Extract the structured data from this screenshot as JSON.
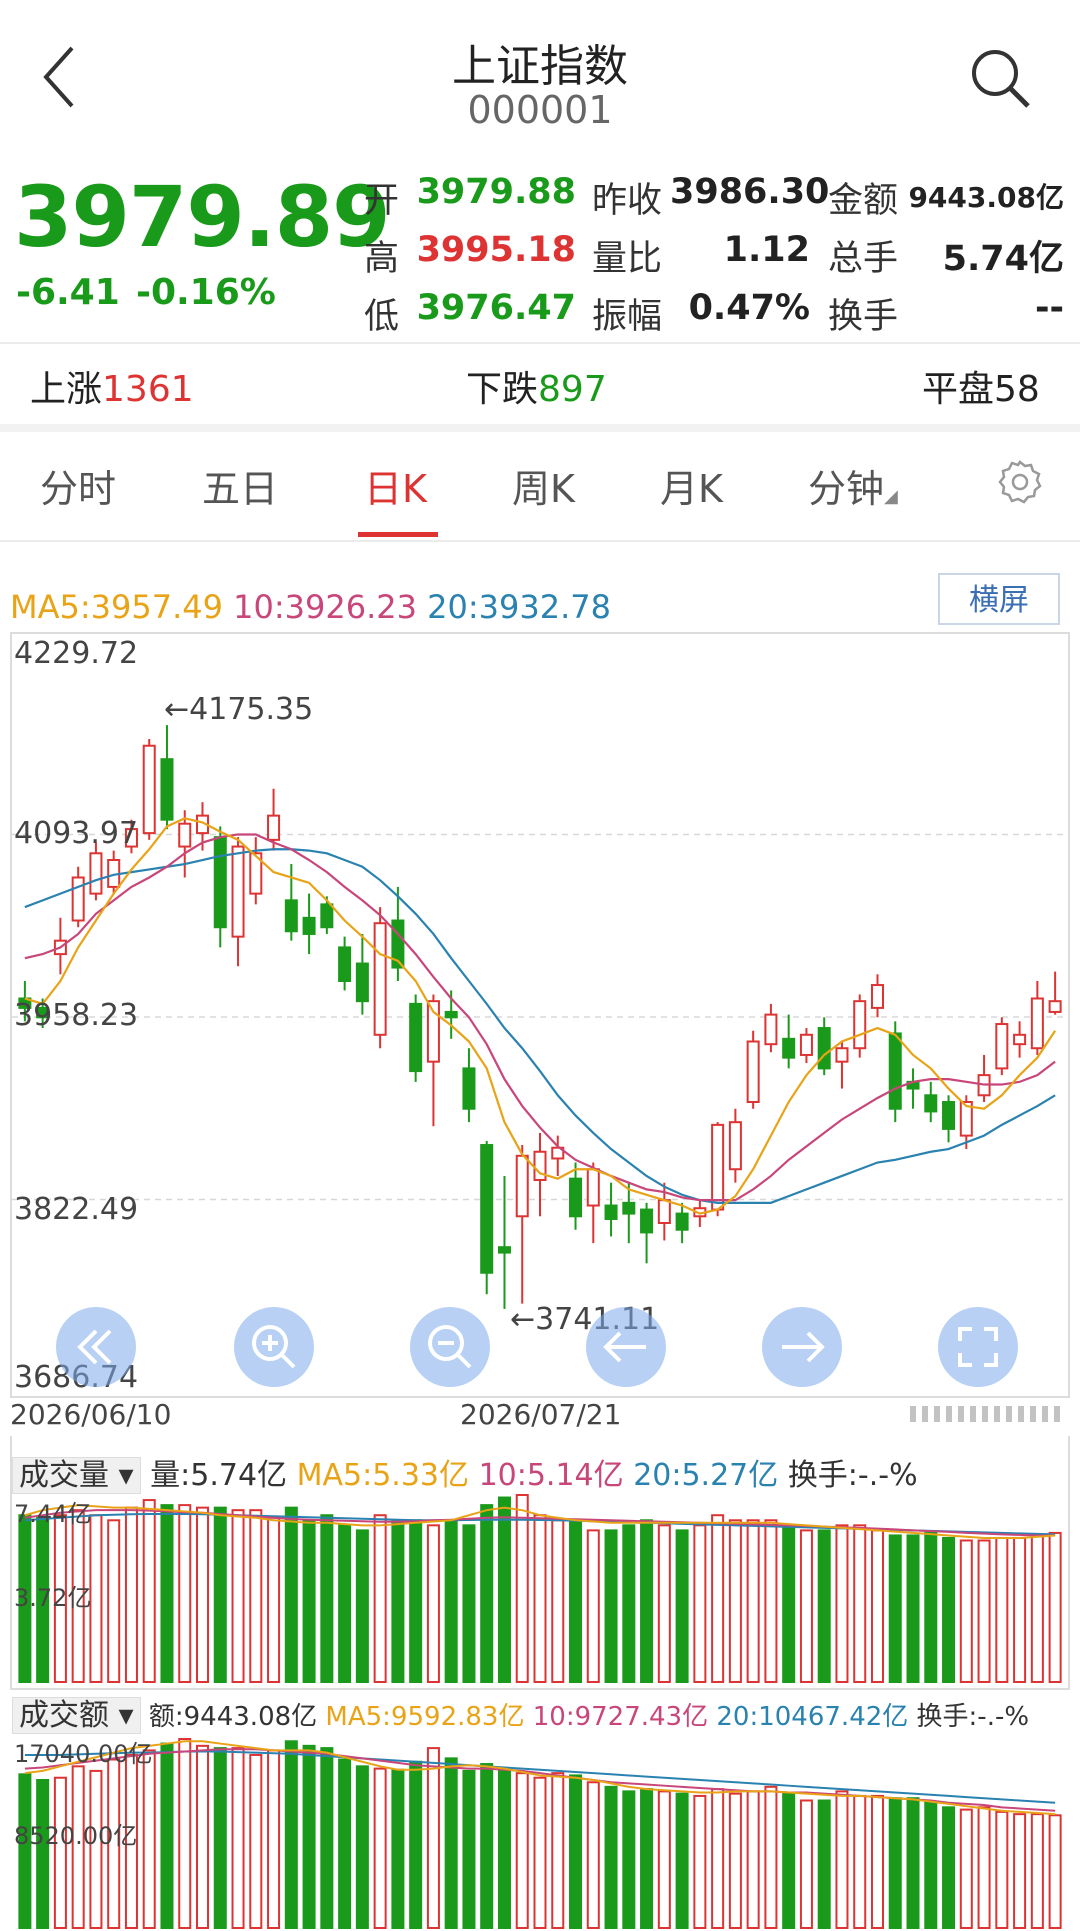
{
  "header": {
    "title": "上证指数",
    "code": "000001"
  },
  "quote": {
    "price": "3979.89",
    "change": "-6.41",
    "change_pct": "-0.16%",
    "labels": {
      "open": "开",
      "high": "高",
      "low": "低",
      "prev_close": "昨收",
      "vol_ratio": "量比",
      "amplitude": "振幅",
      "amount": "金额",
      "total_hands": "总手",
      "turnover": "换手"
    },
    "open": "3979.88",
    "high": "3995.18",
    "low": "3976.47",
    "prev_close": "3986.30",
    "vol_ratio": "1.12",
    "amplitude": "0.47%",
    "amount": "9443.08亿",
    "total_hands": "5.74亿",
    "turnover": "--"
  },
  "breadth": {
    "up_label": "上涨",
    "up": "1361",
    "down_label": "下跌",
    "down": "897",
    "flat_label": "平盘",
    "flat": "58"
  },
  "tabs": [
    "分时",
    "五日",
    "日K",
    "周K",
    "月K",
    "分钟"
  ],
  "active_tab": "日K",
  "ma_legend": {
    "ma5": "MA5:3957.49",
    "ma10": "10:3926.23",
    "ma20": "20:3932.78"
  },
  "landscape_label": "横屏",
  "colors": {
    "up": "#dd3333",
    "down": "#1a9a1a",
    "ma5": "#e8a317",
    "ma10": "#c8467a",
    "ma20": "#2a82b0"
  },
  "nav_icons": [
    "double-left-icon",
    "zoom-in-icon",
    "zoom-out-icon",
    "arrow-left-icon",
    "arrow-right-icon",
    "fullscreen-icon"
  ],
  "chart_data": {
    "type": "candlestick",
    "y_ticks": [
      "4229.72",
      "4093.97",
      "3958.23",
      "3822.49",
      "3686.74"
    ],
    "ylim": [
      3686.74,
      4229.72
    ],
    "x_labels": [
      "2026/06/10",
      "2026/07/21"
    ],
    "annotations": {
      "max": "4175.35",
      "min": "3741.11"
    },
    "candles": [
      {
        "o": 3972,
        "c": 3965,
        "h": 3985,
        "l": 3955
      },
      {
        "o": 3965,
        "c": 3958,
        "h": 3972,
        "l": 3950
      },
      {
        "o": 4005,
        "c": 4015,
        "h": 4032,
        "l": 3990
      },
      {
        "o": 4030,
        "c": 4062,
        "h": 4070,
        "l": 4025
      },
      {
        "o": 4050,
        "c": 4080,
        "h": 4088,
        "l": 4045
      },
      {
        "o": 4055,
        "c": 4075,
        "h": 4082,
        "l": 4050
      },
      {
        "o": 4085,
        "c": 4098,
        "h": 4105,
        "l": 4080
      },
      {
        "o": 4095,
        "c": 4160,
        "h": 4165,
        "l": 4090
      },
      {
        "o": 4150,
        "c": 4105,
        "h": 4175.35,
        "l": 4098
      },
      {
        "o": 4085,
        "c": 4102,
        "h": 4112,
        "l": 4062
      },
      {
        "o": 4095,
        "c": 4108,
        "h": 4118,
        "l": 4082
      },
      {
        "o": 4092,
        "c": 4025,
        "h": 4100,
        "l": 4010
      },
      {
        "o": 4018,
        "c": 4085,
        "h": 4092,
        "l": 3996
      },
      {
        "o": 4050,
        "c": 4080,
        "h": 4092,
        "l": 4042
      },
      {
        "o": 4090,
        "c": 4108,
        "h": 4128,
        "l": 4082
      },
      {
        "o": 4045,
        "c": 4022,
        "h": 4072,
        "l": 4015
      },
      {
        "o": 4032,
        "c": 4020,
        "h": 4050,
        "l": 4005
      },
      {
        "o": 4042,
        "c": 4025,
        "h": 4048,
        "l": 4020
      },
      {
        "o": 4010,
        "c": 3985,
        "h": 4018,
        "l": 3978
      },
      {
        "o": 3998,
        "c": 3970,
        "h": 4020,
        "l": 3960
      },
      {
        "o": 3945,
        "c": 4028,
        "h": 4040,
        "l": 3935
      },
      {
        "o": 4030,
        "c": 3995,
        "h": 4055,
        "l": 3985
      },
      {
        "o": 3968,
        "c": 3918,
        "h": 3975,
        "l": 3910
      },
      {
        "o": 3925,
        "c": 3970,
        "h": 3975,
        "l": 3877
      },
      {
        "o": 3962,
        "c": 3958,
        "h": 3978,
        "l": 3942
      },
      {
        "o": 3920,
        "c": 3890,
        "h": 3935,
        "l": 3880
      },
      {
        "o": 3863,
        "c": 3768,
        "h": 3866,
        "l": 3752
      },
      {
        "o": 3787,
        "c": 3783,
        "h": 3840,
        "l": 3741.11
      },
      {
        "o": 3810,
        "c": 3855,
        "h": 3863,
        "l": 3745
      },
      {
        "o": 3837,
        "c": 3858,
        "h": 3872,
        "l": 3810
      },
      {
        "o": 3853,
        "c": 3861,
        "h": 3870,
        "l": 3840
      },
      {
        "o": 3838,
        "c": 3810,
        "h": 3850,
        "l": 3800
      },
      {
        "o": 3818,
        "c": 3845,
        "h": 3850,
        "l": 3790
      },
      {
        "o": 3818,
        "c": 3808,
        "h": 3835,
        "l": 3795
      },
      {
        "o": 3820,
        "c": 3812,
        "h": 3835,
        "l": 3790
      },
      {
        "o": 3815,
        "c": 3798,
        "h": 3820,
        "l": 3775
      },
      {
        "o": 3805,
        "c": 3822,
        "h": 3835,
        "l": 3792
      },
      {
        "o": 3812,
        "c": 3800,
        "h": 3820,
        "l": 3790
      },
      {
        "o": 3810,
        "c": 3816,
        "h": 3822,
        "l": 3802
      },
      {
        "o": 3815,
        "c": 3878,
        "h": 3880,
        "l": 3810
      },
      {
        "o": 3845,
        "c": 3880,
        "h": 3890,
        "l": 3835
      },
      {
        "o": 3895,
        "c": 3940,
        "h": 3948,
        "l": 3890
      },
      {
        "o": 3938,
        "c": 3960,
        "h": 3968,
        "l": 3932
      },
      {
        "o": 3942,
        "c": 3928,
        "h": 3960,
        "l": 3920
      },
      {
        "o": 3930,
        "c": 3945,
        "h": 3950,
        "l": 3924
      },
      {
        "o": 3950,
        "c": 3920,
        "h": 3958,
        "l": 3915
      },
      {
        "o": 3925,
        "c": 3935,
        "h": 3940,
        "l": 3905
      },
      {
        "o": 3935,
        "c": 3970,
        "h": 3975,
        "l": 3928
      },
      {
        "o": 3965,
        "c": 3982,
        "h": 3990,
        "l": 3958
      },
      {
        "o": 3946,
        "c": 3890,
        "h": 3955,
        "l": 3880
      },
      {
        "o": 3910,
        "c": 3905,
        "h": 3920,
        "l": 3890
      },
      {
        "o": 3900,
        "c": 3888,
        "h": 3910,
        "l": 3880
      },
      {
        "o": 3895,
        "c": 3875,
        "h": 3900,
        "l": 3865
      },
      {
        "o": 3870,
        "c": 3895,
        "h": 3900,
        "l": 3860
      },
      {
        "o": 3900,
        "c": 3915,
        "h": 3930,
        "l": 3895
      },
      {
        "o": 3920,
        "c": 3953,
        "h": 3958,
        "l": 3915
      },
      {
        "o": 3938,
        "c": 3945,
        "h": 3955,
        "l": 3928
      },
      {
        "o": 3935,
        "c": 3972,
        "h": 3985,
        "l": 3930
      },
      {
        "o": 3962,
        "c": 3970,
        "h": 3992,
        "l": 3960
      }
    ],
    "ma5": [
      3972,
      3968,
      3985,
      4010,
      4030,
      4050,
      4068,
      4083,
      4100,
      4106,
      4103,
      4096,
      4090,
      4078,
      4066,
      4062,
      4058,
      4045,
      4030,
      4018,
      4005,
      4000,
      3985,
      3962,
      3952,
      3940,
      3920,
      3880,
      3856,
      3842,
      3838,
      3845,
      3845,
      3840,
      3830,
      3826,
      3822,
      3818,
      3812,
      3815,
      3825,
      3845,
      3870,
      3895,
      3915,
      3930,
      3940,
      3945,
      3950,
      3945,
      3930,
      3920,
      3905,
      3892,
      3890,
      3900,
      3915,
      3928,
      3948
    ],
    "ma10": [
      4002,
      4005,
      4010,
      4020,
      4035,
      4045,
      4055,
      4062,
      4070,
      4080,
      4088,
      4092,
      4094,
      4094,
      4088,
      4083,
      4075,
      4066,
      4055,
      4045,
      4034,
      4020,
      4005,
      3988,
      3972,
      3958,
      3938,
      3912,
      3892,
      3876,
      3862,
      3852,
      3846,
      3840,
      3835,
      3830,
      3828,
      3824,
      3822,
      3822,
      3822,
      3830,
      3840,
      3852,
      3862,
      3872,
      3882,
      3890,
      3898,
      3905,
      3910,
      3912,
      3912,
      3910,
      3908,
      3908,
      3910,
      3915,
      3925
    ],
    "ma20": [
      4040,
      4045,
      4050,
      4055,
      4060,
      4064,
      4066,
      4068,
      4070,
      4072,
      4075,
      4078,
      4080,
      4082,
      4083,
      4083,
      4082,
      4080,
      4075,
      4070,
      4060,
      4048,
      4035,
      4020,
      4002,
      3985,
      3968,
      3950,
      3935,
      3918,
      3900,
      3885,
      3872,
      3860,
      3850,
      3840,
      3832,
      3826,
      3822,
      3820,
      3820,
      3820,
      3820,
      3825,
      3830,
      3835,
      3840,
      3845,
      3850,
      3852,
      3855,
      3858,
      3860,
      3865,
      3870,
      3878,
      3885,
      3892,
      3900
    ]
  },
  "volume_panel": {
    "tag": "成交量",
    "header": {
      "vol": "量:5.74亿",
      "ma5": "MA5:5.33亿",
      "ma10": "10:5.14亿",
      "ma20": "20:5.27亿",
      "turnover": "换手:-.-%"
    },
    "y_labels": [
      "7.44亿",
      "3.72亿"
    ],
    "ymax": 7.44,
    "values": [
      6.6,
      6.5,
      6.6,
      6.8,
      6.6,
      6.4,
      6.9,
      7.2,
      7.0,
      7.0,
      6.9,
      6.9,
      6.8,
      6.8,
      6.5,
      6.9,
      6.4,
      6.6,
      6.2,
      6.0,
      6.6,
      6.4,
      6.4,
      6.2,
      6.4,
      6.2,
      7.0,
      7.3,
      7.4,
      6.6,
      6.4,
      6.4,
      6.0,
      6.0,
      6.2,
      6.4,
      6.2,
      6.0,
      6.2,
      6.6,
      6.4,
      6.4,
      6.4,
      6.2,
      6.0,
      6.0,
      6.2,
      6.2,
      6.0,
      5.8,
      5.8,
      5.9,
      5.7,
      5.6,
      5.6,
      5.7,
      5.7,
      5.8,
      5.9
    ],
    "ma5": [
      6.6,
      6.8,
      6.9,
      7.0,
      6.95,
      6.9,
      6.9,
      6.85,
      6.8,
      6.75,
      6.7,
      6.6,
      6.55,
      6.5,
      6.4,
      6.35,
      6.3,
      6.3,
      6.25,
      6.2,
      6.2,
      6.25,
      6.3,
      6.35,
      6.4,
      6.6,
      6.8,
      6.9,
      6.8,
      6.6,
      6.5,
      6.4,
      6.35,
      6.3,
      6.3,
      6.3,
      6.3,
      6.3,
      6.3,
      6.3,
      6.3,
      6.3,
      6.3,
      6.25,
      6.2,
      6.15,
      6.1,
      6.05,
      6.0,
      5.95,
      5.9,
      5.85,
      5.8,
      5.75,
      5.7,
      5.7,
      5.7,
      5.75,
      5.8
    ],
    "ma10": [
      6.5,
      6.6,
      6.7,
      6.75,
      6.8,
      6.8,
      6.8,
      6.78,
      6.75,
      6.72,
      6.7,
      6.65,
      6.6,
      6.55,
      6.5,
      6.45,
      6.42,
      6.4,
      6.38,
      6.36,
      6.34,
      6.34,
      6.36,
      6.4,
      6.42,
      6.46,
      6.5,
      6.52,
      6.5,
      6.48,
      6.46,
      6.44,
      6.42,
      6.4,
      6.38,
      6.36,
      6.34,
      6.32,
      6.3,
      6.28,
      6.26,
      6.24,
      6.22,
      6.2,
      6.18,
      6.15,
      6.12,
      6.1,
      6.07,
      6.04,
      6.0,
      5.97,
      5.94,
      5.9,
      5.87,
      5.84,
      5.82,
      5.8,
      5.8
    ],
    "ma20": [
      6.4,
      6.45,
      6.5,
      6.55,
      6.6,
      6.62,
      6.64,
      6.65,
      6.65,
      6.65,
      6.64,
      6.62,
      6.6,
      6.58,
      6.56,
      6.54,
      6.52,
      6.5,
      6.48,
      6.46,
      6.44,
      6.42,
      6.4,
      6.4,
      6.4,
      6.41,
      6.42,
      6.42,
      6.42,
      6.41,
      6.4,
      6.38,
      6.36,
      6.34,
      6.32,
      6.3,
      6.28,
      6.26,
      6.24,
      6.22,
      6.2,
      6.18,
      6.16,
      6.14,
      6.12,
      6.1,
      6.08,
      6.06,
      6.04,
      6.02,
      6.0,
      5.98,
      5.96,
      5.94,
      5.92,
      5.9,
      5.88,
      5.86,
      5.84
    ]
  },
  "amount_panel": {
    "tag": "成交额",
    "header": {
      "amt": "额:9443.08亿",
      "ma5": "MA5:9592.83亿",
      "ma10": "10:9727.43亿",
      "ma20": "20:10467.42亿",
      "turnover": "换手:-.-%"
    },
    "y_labels": [
      "17040.00亿",
      "8520.00亿"
    ],
    "ymax": 17040,
    "values": [
      13500,
      13000,
      13200,
      14200,
      13800,
      14800,
      15200,
      15600,
      16200,
      16600,
      16000,
      15800,
      15800,
      15200,
      15600,
      16400,
      16000,
      15800,
      14800,
      14200,
      14000,
      13900,
      14600,
      15800,
      14900,
      13800,
      14400,
      14000,
      13600,
      13200,
      13600,
      13400,
      12800,
      12400,
      12000,
      12200,
      12000,
      11800,
      11600,
      12200,
      11800,
      12000,
      12400,
      11800,
      11200,
      11200,
      12000,
      11600,
      11600,
      11400,
      11400,
      11100,
      10600,
      10400,
      10600,
      10200,
      10000,
      10000,
      9900
    ],
    "ma5": [
      13600,
      13800,
      14200,
      14600,
      15000,
      15400,
      15800,
      16000,
      16200,
      16400,
      16400,
      16200,
      16000,
      15800,
      15600,
      15600,
      15600,
      15400,
      15000,
      14600,
      14200,
      13900,
      13900,
      14000,
      14200,
      14300,
      14200,
      14000,
      13700,
      13400,
      13300,
      13200,
      13000,
      12700,
      12400,
      12200,
      12100,
      12000,
      11900,
      11900,
      12000,
      12000,
      12000,
      11900,
      11800,
      11700,
      11600,
      11600,
      11500,
      11400,
      11300,
      11100,
      10900,
      10700,
      10500,
      10300,
      10200,
      10100,
      10000
    ],
    "ma10": [
      14000,
      14100,
      14300,
      14500,
      14700,
      14900,
      15100,
      15300,
      15400,
      15500,
      15600,
      15700,
      15700,
      15700,
      15600,
      15500,
      15400,
      15300,
      15100,
      14900,
      14700,
      14500,
      14300,
      14200,
      14100,
      14000,
      14000,
      13900,
      13800,
      13600,
      13400,
      13200,
      13000,
      12800,
      12700,
      12600,
      12500,
      12400,
      12300,
      12200,
      12100,
      12000,
      12000,
      11900,
      11900,
      11800,
      11700,
      11600,
      11500,
      11400,
      11300,
      11200,
      11000,
      10900,
      10800,
      10600,
      10500,
      10400,
      10300
    ],
    "ma20": [
      15200,
      15200,
      15200,
      15250,
      15300,
      15350,
      15400,
      15400,
      15450,
      15500,
      15500,
      15500,
      15450,
      15400,
      15350,
      15300,
      15200,
      15100,
      15000,
      14900,
      14800,
      14700,
      14600,
      14500,
      14400,
      14300,
      14200,
      14100,
      14000,
      13900,
      13800,
      13700,
      13600,
      13500,
      13400,
      13300,
      13200,
      13100,
      13000,
      12900,
      12800,
      12700,
      12600,
      12500,
      12400,
      12300,
      12200,
      12100,
      12000,
      11900,
      11800,
      11700,
      11600,
      11500,
      11400,
      11300,
      11200,
      11100,
      11000
    ]
  }
}
